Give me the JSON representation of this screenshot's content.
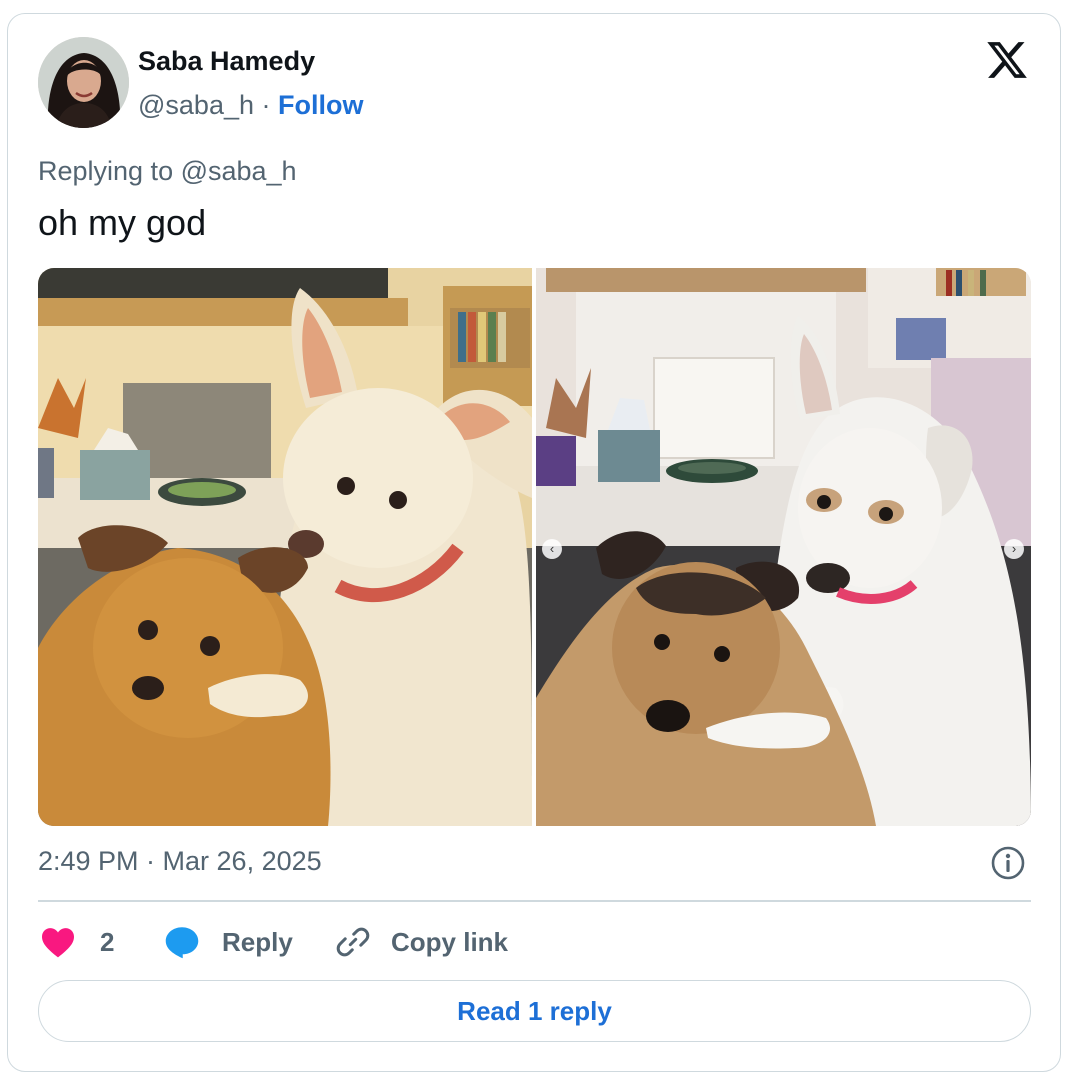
{
  "author": {
    "name": "Saba Hamedy",
    "handle": "@saba_h",
    "separator": "·",
    "follow_label": "Follow"
  },
  "tweet": {
    "replying_to": "Replying to @saba_h",
    "text": "oh my god",
    "timestamp": "2:49 PM · Mar 26, 2025"
  },
  "media": {
    "images": [
      {
        "kind": "illustration",
        "subject": "dogs"
      },
      {
        "kind": "photo",
        "subject": "dogs"
      }
    ],
    "nav_prev_icon": "chevron-left-icon",
    "nav_next_icon": "chevron-right-icon"
  },
  "actions": {
    "like_count": "2",
    "reply_label": "Reply",
    "copy_link_label": "Copy link"
  },
  "read_replies_label": "Read 1 reply",
  "colors": {
    "like": "#f91880",
    "reply": "#1d9bf0",
    "link": "#1d6fd6",
    "muted": "#536471",
    "border": "#cfd9de"
  }
}
